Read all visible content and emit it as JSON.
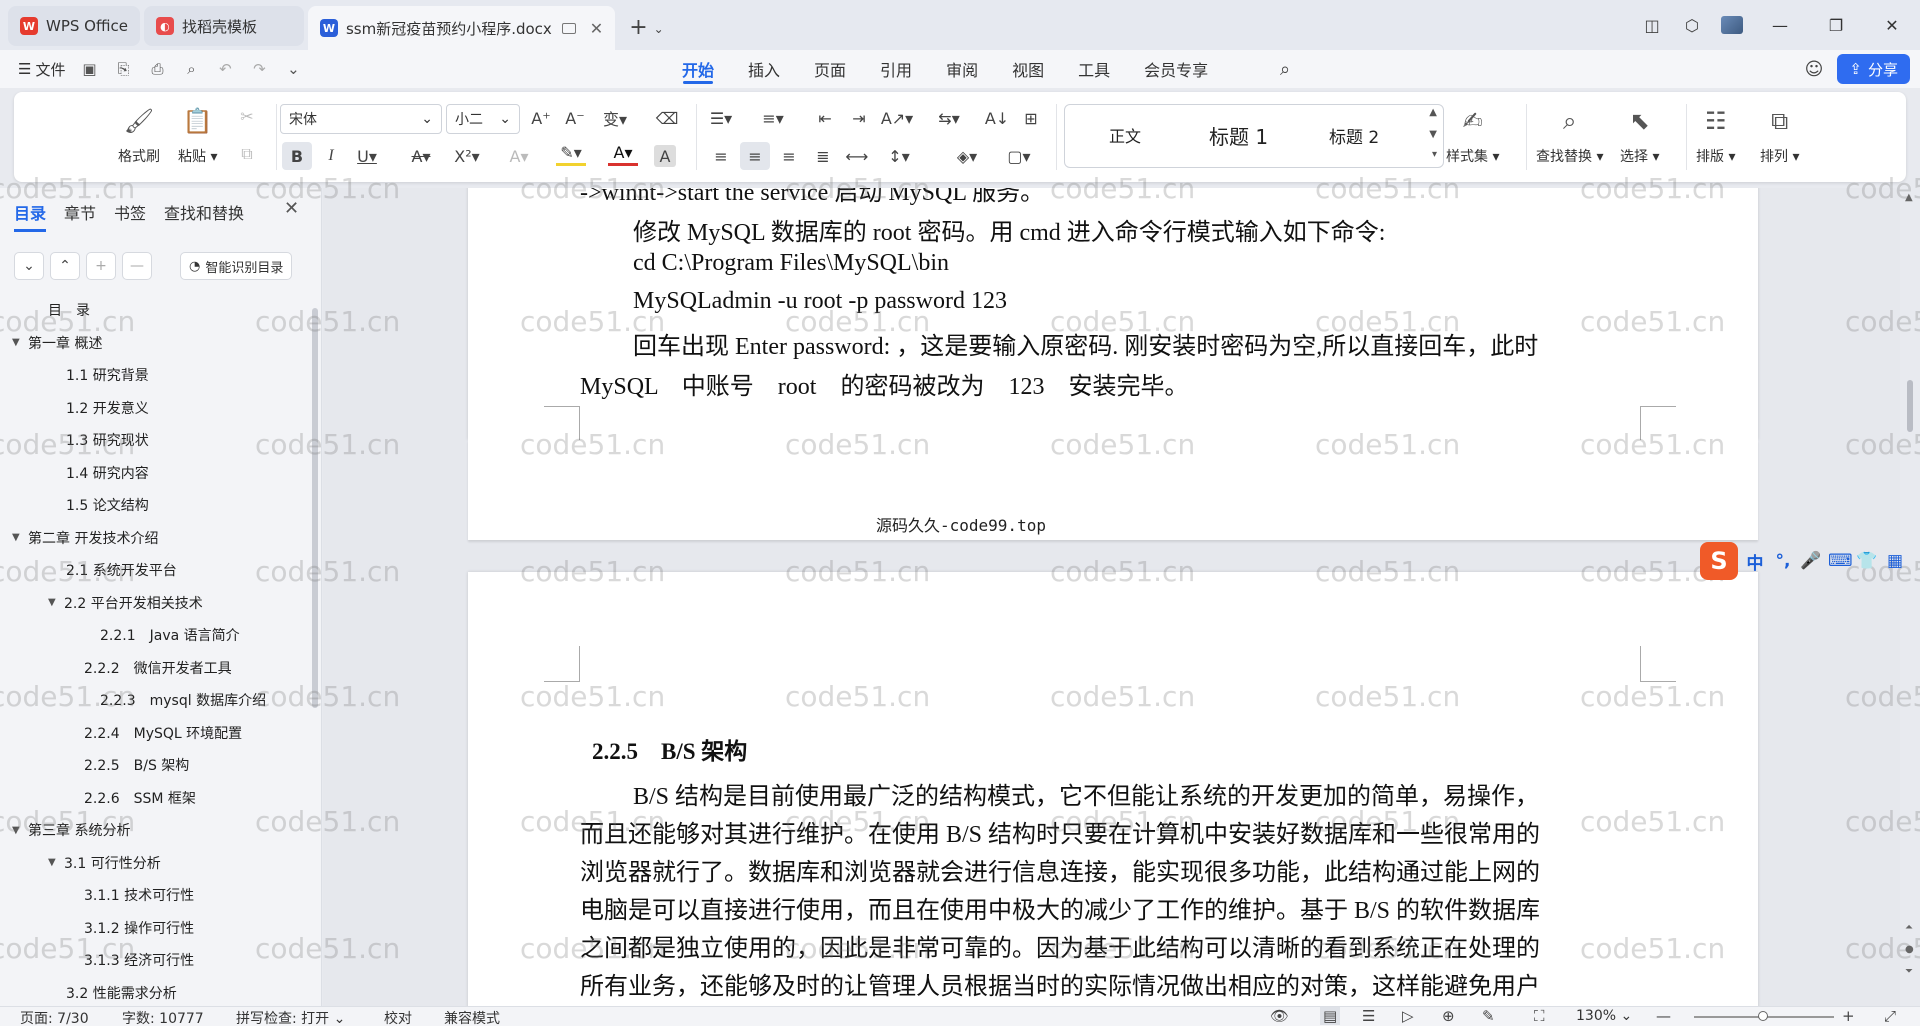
{
  "tabs": [
    {
      "label": "WPS Office",
      "icon": "wps-logo-icon",
      "color": "#e63b2e"
    },
    {
      "label": "找稻壳模板",
      "icon": "docer-logo-icon",
      "color": "#e84c4c"
    },
    {
      "label": "ssm新冠疫苗预约小程序.docx",
      "icon": "word-doc-icon",
      "color": "#2b5fd9"
    }
  ],
  "menu": {
    "file_label": "文件",
    "tabs": [
      "开始",
      "插入",
      "页面",
      "引用",
      "审阅",
      "视图",
      "工具",
      "会员专享"
    ],
    "active_tab": "开始",
    "share_label": "分享"
  },
  "ribbon": {
    "format_painter": "格式刷",
    "paste": "粘贴",
    "font_name": "宋体",
    "font_size": "小二",
    "styles": [
      "正文",
      "标题 1",
      "标题 2"
    ],
    "style_set": "样式集",
    "find_replace": "查找替换",
    "select": "选择",
    "layout": "排版",
    "arrange": "排列"
  },
  "leftpane": {
    "tabs": [
      "目录",
      "章节",
      "书签",
      "查找和替换"
    ],
    "active_tab": "目录",
    "smart_toc": "智能识别目录",
    "toc": [
      {
        "label": "目　录",
        "level": 0,
        "arrow": ""
      },
      {
        "label": "第一章 概述",
        "level": 0,
        "arrow": "▼"
      },
      {
        "label": "1.1 研究背景",
        "level": 1,
        "arrow": ""
      },
      {
        "label": "1.2 开发意义",
        "level": 1,
        "arrow": ""
      },
      {
        "label": "1.3 研究现状",
        "level": 1,
        "arrow": ""
      },
      {
        "label": "1.4 研究内容",
        "level": 1,
        "arrow": ""
      },
      {
        "label": "1.5 论文结构",
        "level": 1,
        "arrow": ""
      },
      {
        "label": "第二章 开发技术介绍",
        "level": 0,
        "arrow": "▼"
      },
      {
        "label": "2.1 系统开发平台",
        "level": 1,
        "arrow": ""
      },
      {
        "label": "2.2 平台开发相关技术",
        "level": 1,
        "arrow": "▼"
      },
      {
        "label": "2.2.1　Java 语言简介",
        "level": 3,
        "arrow": ""
      },
      {
        "label": "2.2.2　微信开发者工具",
        "level": 2,
        "arrow": ""
      },
      {
        "label": "2.2.3　mysql 数据库介绍",
        "level": 3,
        "arrow": ""
      },
      {
        "label": "2.2.4　MySQL 环境配置",
        "level": 2,
        "arrow": ""
      },
      {
        "label": "2.2.5　B/S 架构",
        "level": 2,
        "arrow": ""
      },
      {
        "label": "2.2.6　SSM 框架",
        "level": 2,
        "arrow": ""
      },
      {
        "label": "第三章 系统分析",
        "level": 0,
        "arrow": "▼"
      },
      {
        "label": "3.1 可行性分析",
        "level": 1,
        "arrow": "▼"
      },
      {
        "label": "3.1.1 技术可行性",
        "level": 2,
        "arrow": ""
      },
      {
        "label": "3.1.2 操作可行性",
        "level": 2,
        "arrow": ""
      },
      {
        "label": "3.1.3 经济可行性",
        "level": 2,
        "arrow": ""
      },
      {
        "label": "3.2 性能需求分析",
        "level": 1,
        "arrow": ""
      }
    ]
  },
  "document": {
    "page1_lines": [
      "->winnt->start the service 启动 MySQL 服务。",
      "修改 MySQL 数据库的 root 密码。用 cmd 进入命令行模式输入如下命令:",
      "cd C:\\Program Files\\MySQL\\bin",
      "MySQLadmin -u root -p password 123",
      "回车出现 Enter password: ，这是要输入原密码. 刚安装时密码为空,所以直接回车，此时",
      "MySQL　中账号　root　的密码被改为　123　安装完毕。"
    ],
    "page1_footer": "源码久久-code99.top",
    "page2_heading": "2.2.5　B/S 架构",
    "page2_lines": [
      "B/S 结构是目前使用最广泛的结构模式，它不但能让系统的开发更加的简单，易操作，",
      "而且还能够对其进行维护。在使用 B/S 结构时只要在计算机中安装好数据库和一些很常用的",
      "浏览器就行了。数据库和浏览器就会进行信息连接，能实现很多功能，此结构通过能上网的",
      "电脑是可以直接进行使用，而且在使用中极大的减少了工作的维护。基于 B/S 的软件数据库",
      "之间都是独立使用的，因此是非常可靠的。因为基于此结构可以清晰的看到系统正在处理的",
      "所有业务，还能够及时的让管理人员根据当时的实际情况做出相应的对策，这样能避免用户"
    ],
    "watermark": "code51.cn"
  },
  "ime": {
    "items": [
      "中",
      "°,",
      "🎤",
      "⌨",
      "👕",
      "▦"
    ]
  },
  "status": {
    "page": "页面: 7/30",
    "words": "字数: 10777",
    "spellcheck": "拼写检查: 打开",
    "proofread": "校对",
    "compat": "兼容模式",
    "zoom": "130%"
  }
}
